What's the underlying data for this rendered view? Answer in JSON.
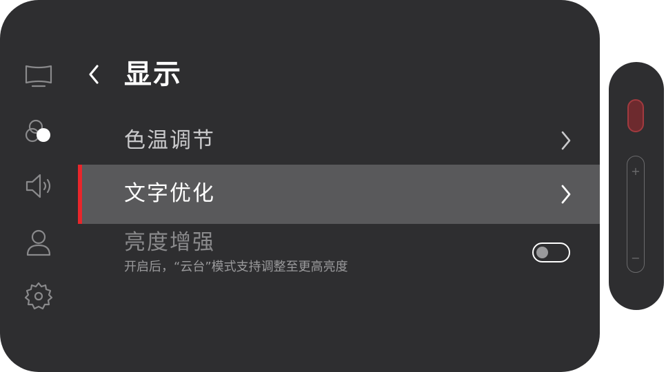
{
  "header": {
    "title": "显示"
  },
  "sidebar": {
    "items": [
      {
        "icon": "display-icon"
      },
      {
        "icon": "color-circles-icon",
        "active": true
      },
      {
        "icon": "speaker-icon"
      },
      {
        "icon": "user-icon"
      },
      {
        "icon": "gear-icon"
      }
    ]
  },
  "menu": {
    "items": [
      {
        "label": "色温调节",
        "type": "submenu"
      },
      {
        "label": "文字优化",
        "type": "submenu",
        "selected": true
      },
      {
        "label": "亮度增强",
        "type": "toggle",
        "on": false,
        "description": "开启后，“云台”模式支持调整至更高亮度"
      }
    ]
  },
  "remote": {
    "volume_up": "+",
    "volume_down": "−"
  },
  "colors": {
    "panel_bg": "#2e2e30",
    "selected_row": "#59595b",
    "accent": "#e8262b",
    "text_primary": "#ffffff",
    "text_secondary": "#c9c9cb",
    "text_disabled": "#8a8a8c"
  }
}
